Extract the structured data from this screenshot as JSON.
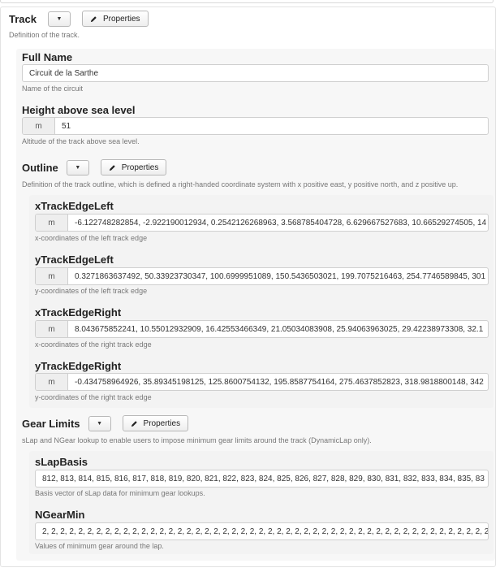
{
  "track": {
    "label": "Track",
    "properties_label": "Properties",
    "description": "Definition of the track."
  },
  "full_name": {
    "label": "Full Name",
    "value": "Circuit de la Sarthe",
    "description": "Name of the circuit"
  },
  "height": {
    "label": "Height above sea level",
    "unit": "m",
    "value": "51",
    "description": "Altitude of the track above sea level."
  },
  "outline": {
    "label": "Outline",
    "properties_label": "Properties",
    "description": "Definition of the track outline, which is defined a right-handed coordinate system with x positive east, y positive north, and z positive up.",
    "fields": [
      {
        "label": "xTrackEdgeLeft",
        "unit": "m",
        "value": "-6.122748282854, -2.922190012934, 0.2542126268963, 3.568785404728, 6.629667527683, 10.66529274505, 14",
        "description": "x-coordinates of the left track edge"
      },
      {
        "label": "yTrackEdgeLeft",
        "unit": "m",
        "value": "0.3271863637492, 50.33923730347, 100.6999951089, 150.5436503021, 199.7075216463, 254.7746589845, 301",
        "description": "y-coordinates of the left track edge"
      },
      {
        "label": "xTrackEdgeRight",
        "unit": "m",
        "value": "8.043675852241, 10.55012932909, 16.42553466349, 21.05034083908, 25.94063963025, 29.42238973308, 32.1",
        "description": "x-coordinates of the right track edge"
      },
      {
        "label": "yTrackEdgeRight",
        "unit": "m",
        "value": "-0.434758964926, 35.89345198125, 125.8600754132, 195.8587754164, 275.4637852823, 318.9818800148, 342",
        "description": "y-coordinates of the right track edge"
      }
    ]
  },
  "gear_limits": {
    "label": "Gear Limits",
    "properties_label": "Properties",
    "description": "sLap and NGear lookup to enable users to impose minimum gear limits around the track (DynamicLap only).",
    "fields": [
      {
        "label": "sLapBasis",
        "value": "812, 813, 814, 815, 816, 817, 818, 819, 820, 821, 822, 823, 824, 825, 826, 827, 828, 829, 830, 831, 832, 833, 834, 835, 83",
        "description": "Basis vector of sLap data for minimum gear lookups."
      },
      {
        "label": "NGearMin",
        "value": "2, 2, 2, 2, 2, 2, 2, 2, 2, 2, 2, 2, 2, 2, 2, 2, 2, 2, 2, 2, 2, 2, 2, 2, 2, 2, 2, 2, 2, 2, 2, 2, 2, 2, 2, 2, 2, 2, 2, 2, 2, 2, 2, 2, 2, 2, 2, 2, 2, 2, 2, 2,",
        "description": "Values of minimum gear around the lap."
      }
    ]
  }
}
